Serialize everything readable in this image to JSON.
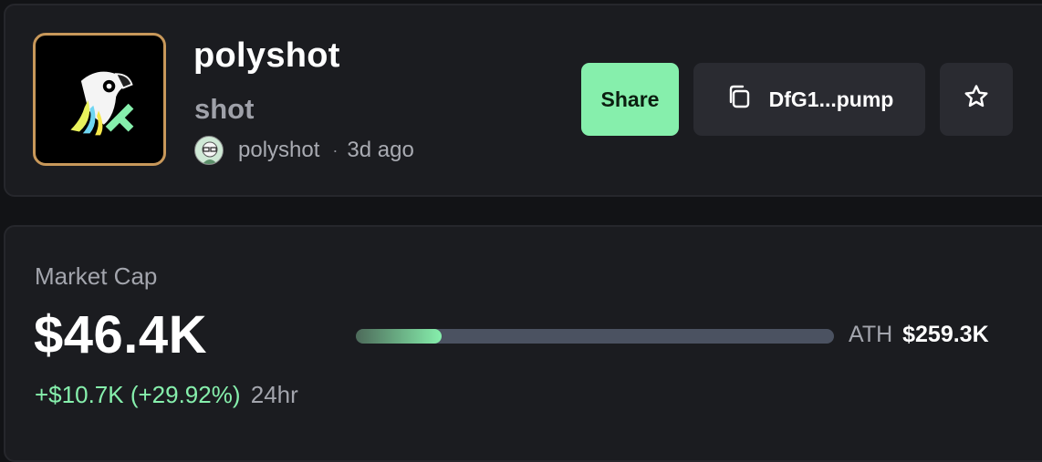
{
  "token": {
    "name": "polyshot",
    "ticker": "shot",
    "creator": "polyshot",
    "separator": "·",
    "age": "3d ago",
    "image_icon": "parrot-logo-icon",
    "avatar_icon": "creator-avatar-icon"
  },
  "actions": {
    "share_label": "Share",
    "address_label": "DfG1...pump",
    "copy_icon": "copy-icon",
    "star_icon": "star-icon"
  },
  "market_cap": {
    "label": "Market Cap",
    "value": "$46.4K",
    "change": "+$10.7K (+29.92%)",
    "period": "24hr",
    "ath_label": "ATH",
    "ath_value": "$259.3K",
    "progress_fraction": 0.18
  },
  "colors": {
    "accent_green": "#86efac",
    "background": "#121316",
    "card": "#1b1c20",
    "token_border": "#c8985a"
  }
}
